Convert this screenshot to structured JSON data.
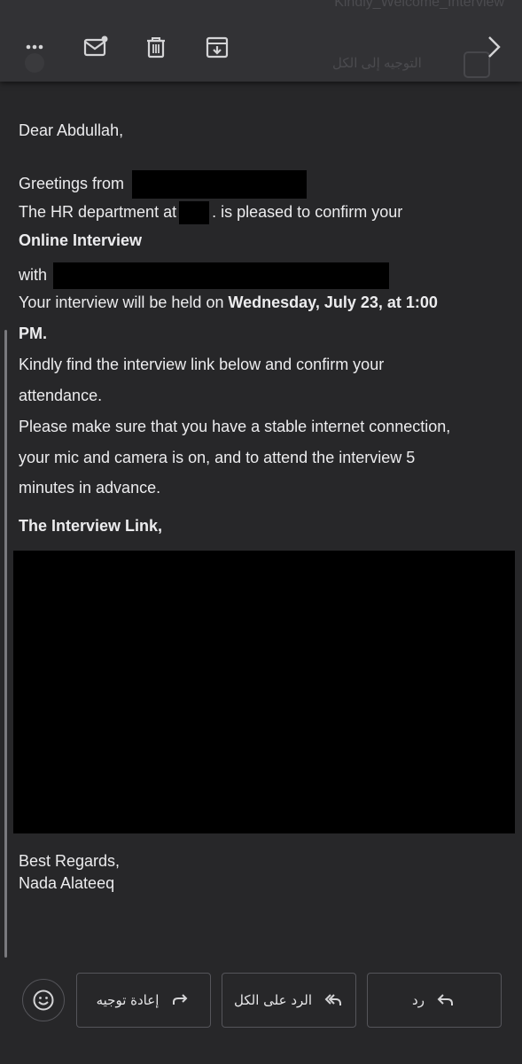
{
  "toolbar": {
    "ghost_top_text": "Kindly_Welcome_Interview",
    "ghost_sub_text": "التوجيه إلى الكل",
    "icons": [
      "more-icon",
      "mark-unread-icon",
      "trash-icon",
      "archive-icon",
      "chevron-right-icon"
    ]
  },
  "email": {
    "greeting": "Dear Abdullah,",
    "greetings_from": "Greetings from",
    "hr_prefix": "The HR department at",
    "hr_suffix": ". is pleased to confirm your",
    "online_interview": "Online Interview",
    "with": "with",
    "held_prefix": "Your interview will be held on",
    "held_date": "Wednesday, July 23, at 1:00",
    "held_pm": "PM.",
    "kindly_1": "Kindly find the interview link below and confirm your",
    "kindly_2": "attendance.",
    "please_1": "Please make sure that you have a stable internet connection,",
    "please_2": "your mic and camera is on, and to attend the interview 5",
    "please_3": "minutes in advance.",
    "link_heading": "The Interview Link,",
    "regards": "Best Regards,",
    "signature": "Nada Alateeq"
  },
  "actions": {
    "forward": "إعادة توجيه",
    "reply_all": "الرد على الكل",
    "reply": "رد"
  }
}
